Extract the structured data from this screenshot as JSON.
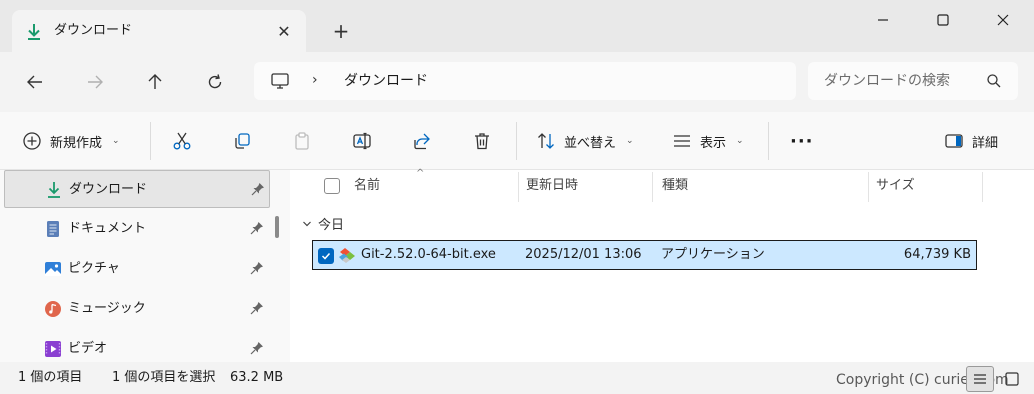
{
  "window": {
    "tab_title": "ダウンロード",
    "tab_close_glyph": "✕",
    "new_tab_glyph": "+"
  },
  "address": {
    "chevron": "›",
    "path": "ダウンロード",
    "search_placeholder": "ダウンロードの検索"
  },
  "toolbar": {
    "new_label": "新規作成",
    "sort_label": "並べ替え",
    "view_label": "表示",
    "more_label": "···",
    "details_label": "詳細"
  },
  "sidebar": {
    "items": [
      {
        "label": "ダウンロード",
        "icon": "download-icon",
        "selected": true
      },
      {
        "label": "ドキュメント",
        "icon": "documents-icon"
      },
      {
        "label": "ピクチャ",
        "icon": "pictures-icon"
      },
      {
        "label": "ミュージック",
        "icon": "music-icon"
      },
      {
        "label": "ビデオ",
        "icon": "videos-icon"
      }
    ]
  },
  "columns": {
    "name": "名前",
    "date": "更新日時",
    "type": "種類",
    "size": "サイズ"
  },
  "group": {
    "label": "今日"
  },
  "files": [
    {
      "name": "Git-2.52.0-64-bit.exe",
      "date": "2025/12/01 13:06",
      "type": "アプリケーション",
      "size": "64,739 KB",
      "selected": true
    }
  ],
  "status": {
    "item_count": "1 個の項目",
    "selection": "1 個の項目を選択",
    "selection_size": "63.2 MB"
  },
  "watermark": "Copyright (C) curiet.com",
  "colors": {
    "accent": "#0067c0",
    "selection_bg": "#cce8ff",
    "download_green": "#1a9a6c"
  }
}
